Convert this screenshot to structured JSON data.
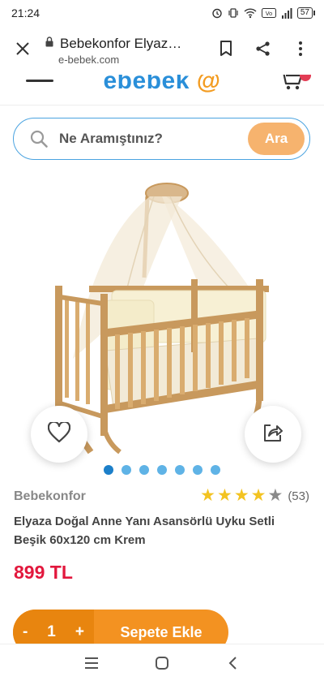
{
  "status_bar": {
    "time": "21:24",
    "battery": "57",
    "icons": [
      "alarm-icon",
      "vibrate-icon",
      "wifi-icon",
      "volte-icon",
      "signal-icon",
      "battery-icon"
    ]
  },
  "browser": {
    "tab_title": "Bebekonfor Elyaz…",
    "domain": "e-bebek.com",
    "icons": [
      "close-icon",
      "lock-icon",
      "bookmark-icon",
      "share-icon",
      "more-icon"
    ]
  },
  "site": {
    "logo": "ebebek"
  },
  "search": {
    "placeholder": "Ne Aramıştınız?",
    "button_label": "Ara"
  },
  "product": {
    "brand": "Bebekonfor",
    "rating_value": 4,
    "rating_max": 5,
    "rating_count": "(53)",
    "title": "Elyaza Doğal Anne Yanı Asansörlü Uyku Setli Beşik 60x120 cm Krem",
    "price": "899 TL",
    "image_count": 7,
    "active_image": 1
  },
  "cart": {
    "decrement": "-",
    "quantity": "1",
    "increment": "+",
    "add_label": "Sepete Ekle"
  },
  "colors": {
    "brand_blue": "#2a8fd9",
    "accent_orange": "#f39221",
    "price_red": "#e2183d",
    "star_yellow": "#f3c321"
  }
}
